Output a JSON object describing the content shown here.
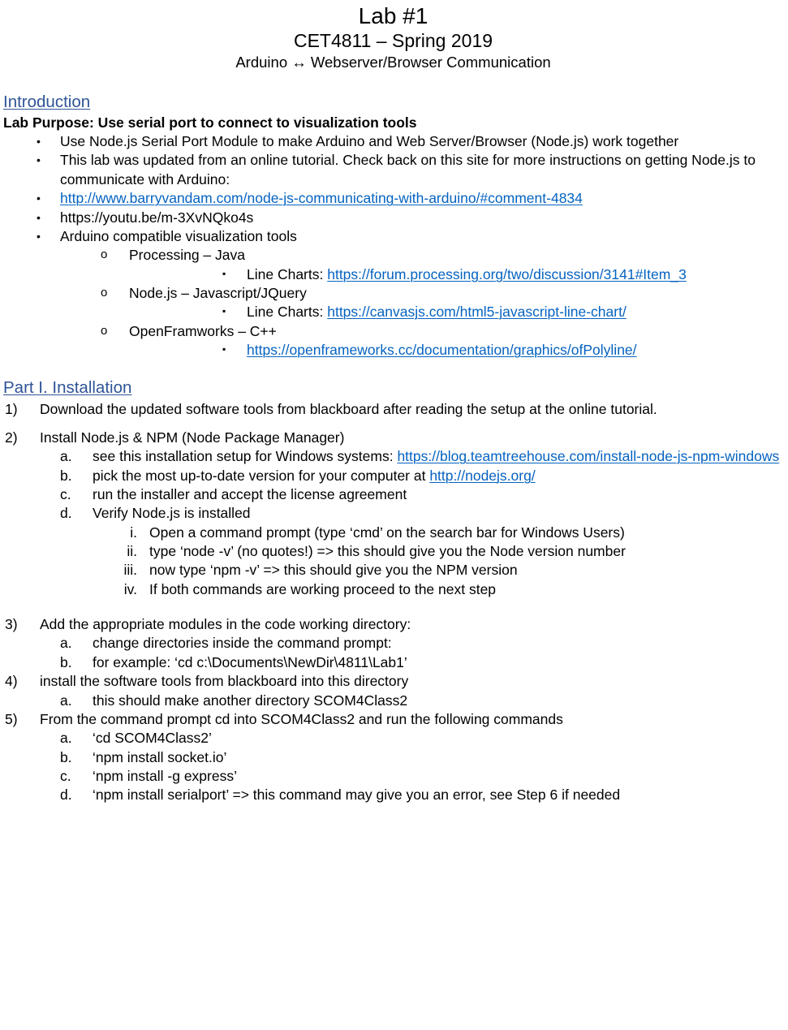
{
  "document": {
    "title": "Lab #1",
    "subtitle": "CET4811 – Spring 2019",
    "subtitle2": "Arduino ↔ Webserver/Browser Communication"
  },
  "colors": {
    "heading_blue": "#2F5496",
    "hyperlink_blue": "#0563C1",
    "text_black": "#000000"
  },
  "markers": {
    "bullet": "•",
    "circle": "o",
    "square": "▪"
  },
  "introduction": {
    "heading": "Introduction",
    "purpose": "Lab Purpose: Use serial port to connect to visualization tools",
    "bullets": [
      {
        "text": "Use Node.js Serial Port Module to make Arduino and Web Server/Browser (Node.js) work together"
      },
      {
        "text": "This lab was updated from an online tutorial. Check back on this site for more instructions on getting Node.js to communicate with Arduino:"
      },
      {
        "link": "http://www.barryvandam.com/node-js-communicating-with-arduino/#comment-4834"
      },
      {
        "text": "https://youtu.be/m-3XvNQko4s"
      },
      {
        "text": "Arduino compatible visualization tools"
      }
    ],
    "tools": [
      {
        "name": "Processing – Java",
        "sub_label": "Line Charts: ",
        "sub_link": "https://forum.processing.org/two/discussion/3141#Item_3"
      },
      {
        "name": "Node.js – Javascript/JQuery",
        "sub_label": "Line Charts: ",
        "sub_link": "https://canvasjs.com/html5-javascript-line-chart/"
      },
      {
        "name": "OpenFramworks – C++",
        "sub_label": "",
        "sub_link": "https://openframeworks.cc/documentation/graphics/ofPolyline/"
      }
    ]
  },
  "part1": {
    "heading": "Part I. Installation",
    "step1": {
      "marker": "1)",
      "text": "Download the updated software tools from blackboard after reading the setup at the online tutorial."
    },
    "step2": {
      "marker": "2)",
      "text": "Install Node.js & NPM (Node Package Manager)",
      "a_marker": "a.",
      "a_text": "see this installation setup for Windows systems: ",
      "a_link": "https://blog.teamtreehouse.com/install-node-js-npm-windows",
      "b_marker": "b.",
      "b_text": "pick the most up-to-date version for your computer at ",
      "b_link": "http://nodejs.org/",
      "c_marker": "c.",
      "c_text": "run the installer and accept the license agreement",
      "d_marker": "d.",
      "d_text": "Verify Node.js is installed",
      "romans": [
        {
          "marker": "i.",
          "text": "Open a command prompt (type ‘cmd’ on the search bar for Windows Users)"
        },
        {
          "marker": "ii.",
          "text": "type ‘node -v’ (no quotes!) => this should give you the Node version number"
        },
        {
          "marker": "iii.",
          "text": "now type ‘npm -v’ => this should give you the NPM version"
        },
        {
          "marker": "iv.",
          "text": "If both commands are working proceed to the next step"
        }
      ]
    },
    "step3": {
      "marker": "3)",
      "text": "Add the appropriate modules in the code working directory:",
      "a_marker": "a.",
      "a_text": "change directories inside the command prompt:",
      "b_marker": "b.",
      "b_text": "for example: ‘cd c:\\Documents\\NewDir\\4811\\Lab1’"
    },
    "step4": {
      "marker": "4)",
      "text": "install the software tools from blackboard into this directory",
      "a_marker": "a.",
      "a_text": "this should make another directory SCOM4Class2"
    },
    "step5": {
      "marker": "5)",
      "text": "From the command prompt cd into SCOM4Class2 and run the following commands",
      "a_marker": "a.",
      "a_text": "‘cd SCOM4Class2’",
      "b_marker": "b.",
      "b_text": "‘npm install socket.io’",
      "c_marker": "c.",
      "c_text": "‘npm install -g express’",
      "d_marker": "d.",
      "d_text": "‘npm install serialport’   => this command may give you an error, see Step 6 if needed"
    }
  }
}
